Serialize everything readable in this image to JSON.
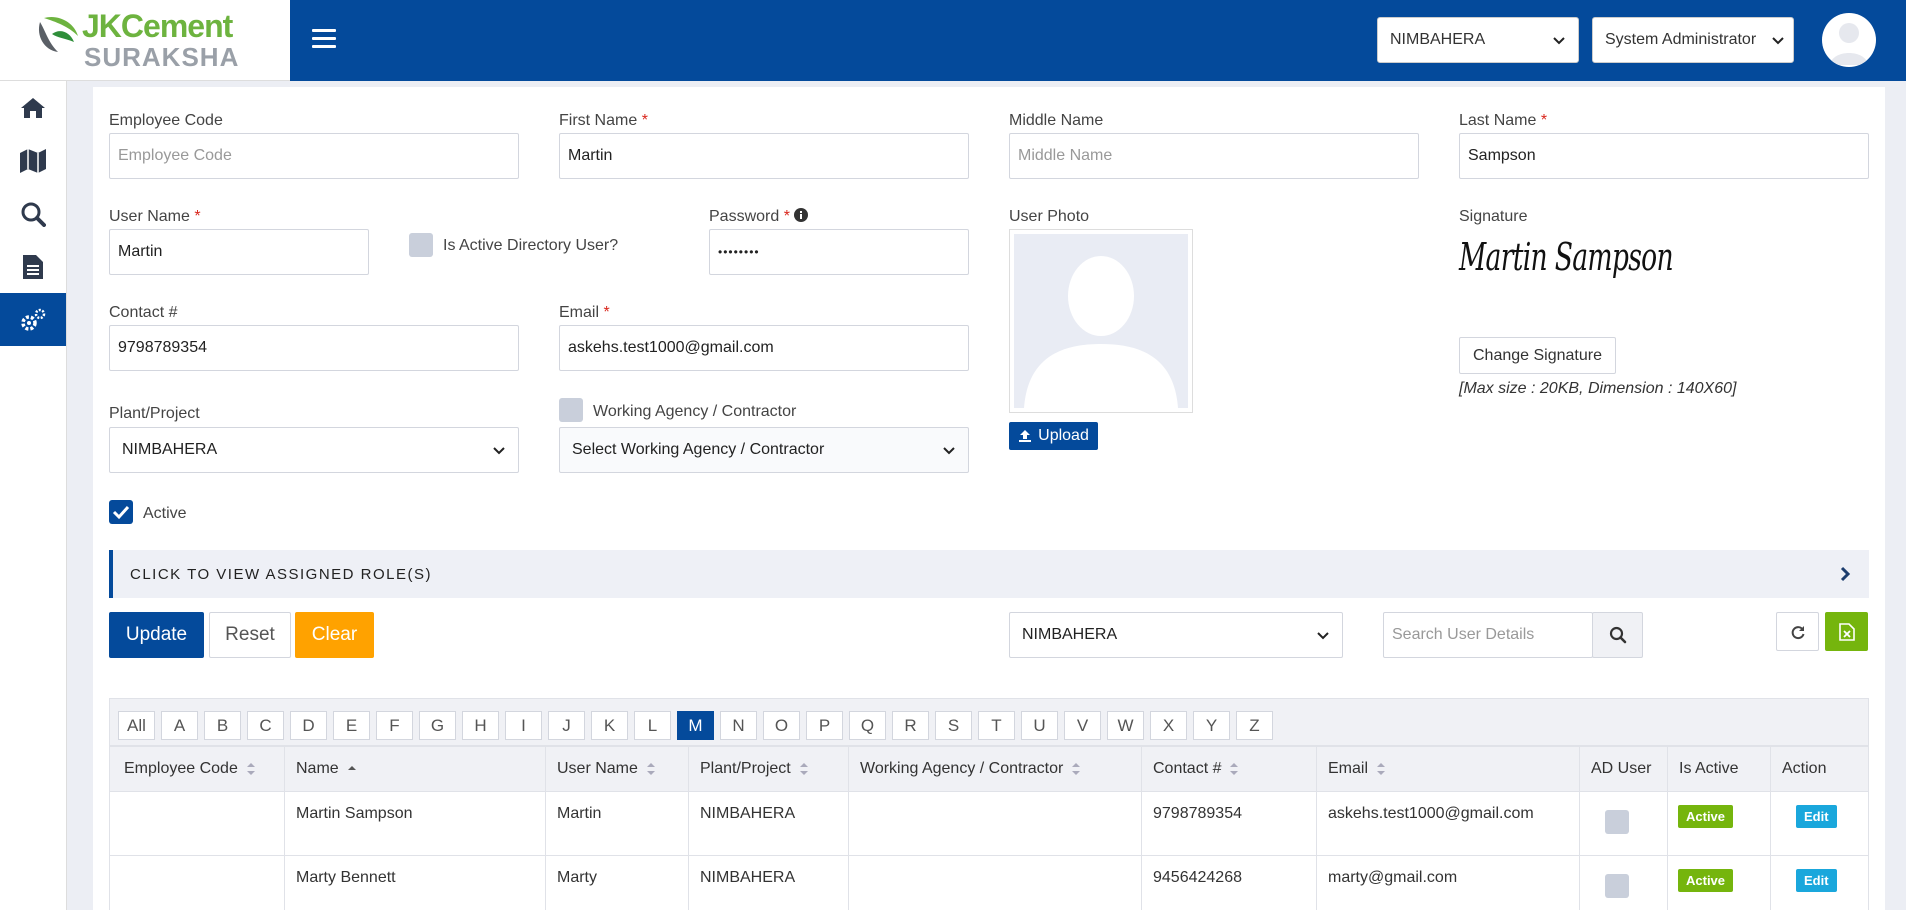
{
  "header": {
    "logo_brand": "JKCement",
    "logo_product": "SURAKSHA",
    "plant_select": "NIMBAHERA",
    "role_select": "System Administrator",
    "accent": "#044a9b"
  },
  "sidebar": {
    "items": [
      {
        "icon": "home-icon"
      },
      {
        "icon": "map-icon"
      },
      {
        "icon": "search-icon"
      },
      {
        "icon": "document-icon"
      },
      {
        "icon": "gears-icon",
        "active": true
      }
    ]
  },
  "form": {
    "employee_code": {
      "label": "Employee Code",
      "value": "",
      "placeholder": "Employee Code"
    },
    "first_name": {
      "label": "First Name",
      "value": "Martin"
    },
    "middle_name": {
      "label": "Middle Name",
      "value": "",
      "placeholder": "Middle Name"
    },
    "last_name": {
      "label": "Last Name",
      "value": "Sampson"
    },
    "user_name": {
      "label": "User Name",
      "value": "Martin"
    },
    "ad_user_label": "Is Active Directory User?",
    "password": {
      "label": "Password",
      "value": "••••••••"
    },
    "user_photo_label": "User Photo",
    "upload_label": "Upload",
    "signature_label": "Signature",
    "signature_text": "Martin Sampson",
    "change_signature_label": "Change Signature",
    "signature_hint": "[Max size : 20KB, Dimension : 140X60]",
    "contact": {
      "label": "Contact #",
      "value": "9798789354"
    },
    "email": {
      "label": "Email",
      "value": "askehs.test1000@gmail.com"
    },
    "plant": {
      "label": "Plant/Project",
      "value": "NIMBAHERA"
    },
    "agency_label": "Working Agency / Contractor",
    "agency_select": "Select Working Agency / Contractor",
    "active_label": "Active",
    "required_mark": "*"
  },
  "roles_bar": "CLICK TO VIEW ASSIGNED ROLE(S)",
  "actions": {
    "update": "Update",
    "reset": "Reset",
    "clear": "Clear"
  },
  "filters": {
    "plant": "NIMBAHERA",
    "search_placeholder": "Search User Details"
  },
  "alphabet": [
    "All",
    "A",
    "B",
    "C",
    "D",
    "E",
    "F",
    "G",
    "H",
    "I",
    "J",
    "K",
    "L",
    "M",
    "N",
    "O",
    "P",
    "Q",
    "R",
    "S",
    "T",
    "U",
    "V",
    "W",
    "X",
    "Y",
    "Z"
  ],
  "alphabet_selected": "M",
  "table": {
    "columns": [
      "Employee Code",
      "Name",
      "User Name",
      "Plant/Project",
      "Working Agency / Contractor",
      "Contact #",
      "Email",
      "AD User",
      "Is Active",
      "Action"
    ],
    "rows": [
      {
        "employee_code": "",
        "name": "Martin Sampson",
        "user_name": "Martin",
        "plant": "NIMBAHERA",
        "agency": "",
        "contact": "9798789354",
        "email": "askehs.test1000@gmail.com",
        "status": "Active",
        "action": "Edit"
      },
      {
        "employee_code": "",
        "name": "Marty Bennett",
        "user_name": "Marty",
        "plant": "NIMBAHERA",
        "agency": "",
        "contact": "9456424268",
        "email": "marty@gmail.com",
        "status": "Active",
        "action": "Edit"
      }
    ]
  }
}
